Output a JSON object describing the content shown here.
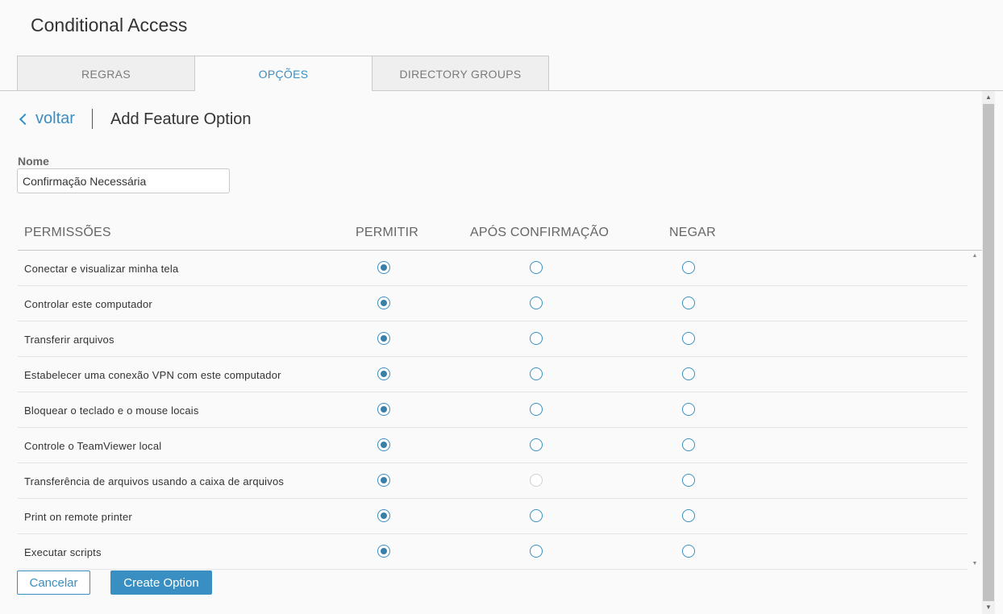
{
  "app": {
    "title": "Conditional Access"
  },
  "tabs": [
    {
      "label": "REGRAS",
      "active": false
    },
    {
      "label": "OPÇÕES",
      "active": true
    },
    {
      "label": "DIRECTORY GROUPS",
      "active": false
    }
  ],
  "header": {
    "back_label": "voltar",
    "page_title": "Add Feature Option"
  },
  "form": {
    "name_label": "Nome",
    "name_value": "Confirmação Necessária"
  },
  "table": {
    "columns": [
      "PERMISSÕES",
      "PERMITIR",
      "APÓS CONFIRMAÇÃO",
      "NEGAR"
    ],
    "rows": [
      {
        "label": "Conectar e visualizar minha tela",
        "selected": "allow",
        "confirm_disabled": false
      },
      {
        "label": "Controlar este computador",
        "selected": "allow",
        "confirm_disabled": false
      },
      {
        "label": "Transferir arquivos",
        "selected": "allow",
        "confirm_disabled": false
      },
      {
        "label": "Estabelecer uma conexão VPN com este computador",
        "selected": "allow",
        "confirm_disabled": false
      },
      {
        "label": "Bloquear o teclado e o mouse locais",
        "selected": "allow",
        "confirm_disabled": false
      },
      {
        "label": "Controle o TeamViewer local",
        "selected": "allow",
        "confirm_disabled": false
      },
      {
        "label": "Transferência de arquivos usando a caixa de arquivos",
        "selected": "allow",
        "confirm_disabled": true
      },
      {
        "label": "Print on remote printer",
        "selected": "allow",
        "confirm_disabled": false
      },
      {
        "label": "Executar scripts",
        "selected": "allow",
        "confirm_disabled": false
      }
    ]
  },
  "actions": {
    "cancel_label": "Cancelar",
    "create_label": "Create Option"
  },
  "colors": {
    "accent": "#3a8fc2",
    "radio_fill": "#3a7fa8"
  }
}
